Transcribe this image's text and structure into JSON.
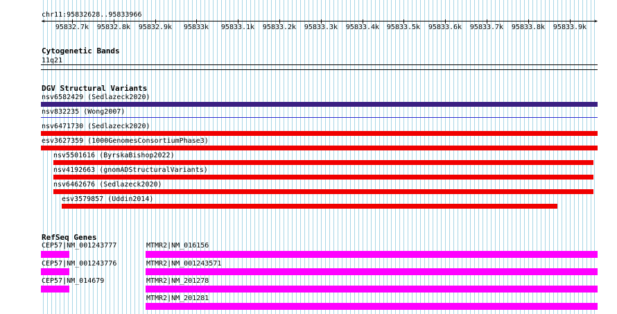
{
  "ruler": {
    "region": "chr11:95832628..95833966",
    "ticks": [
      "95832.7k",
      "95832.8k",
      "95832.9k",
      "95833k",
      "95833.1k",
      "95833.2k",
      "95833.3k",
      "95833.4k",
      "95833.5k",
      "95833.6k",
      "95833.7k",
      "95833.8k",
      "95833.9k"
    ]
  },
  "cytobands": {
    "title": "Cytogenetic Bands",
    "band": "11q21"
  },
  "dgv": {
    "title": "DGV Structural Variants",
    "items": [
      {
        "label": "nsv6582429 (Sedlazeck2020)",
        "color": "#3a1f82"
      },
      {
        "label": "nsv832235 (Wong2007)",
        "color": "#2b2bd0"
      },
      {
        "label": "nsv6471730 (Sedlazeck2020)",
        "color": "#f00000"
      },
      {
        "label": "esv3627359 (1000GenomesConsortiumPhase3)",
        "color": "#f00000"
      },
      {
        "label": "nsv5501616 (ByrskaBishop2022)",
        "color": "#f00000"
      },
      {
        "label": "nsv4192663 (gnomADStructuralVariants)",
        "color": "#f00000"
      },
      {
        "label": "nsv6462676 (Sedlazeck2020)",
        "color": "#f00000"
      },
      {
        "label": "esv3579857 (Uddin2014)",
        "color": "#f00000"
      }
    ]
  },
  "refseq": {
    "title": "RefSeq Genes",
    "color": "#ff00ff",
    "left": [
      "CEP57|NM_001243777",
      "CEP57|NM_001243776",
      "CEP57|NM_014679"
    ],
    "right": [
      "MTMR2|NM_016156",
      "MTMR2|NM_001243571",
      "MTMR2|NM_201278",
      "MTMR2|NM_201281"
    ]
  }
}
